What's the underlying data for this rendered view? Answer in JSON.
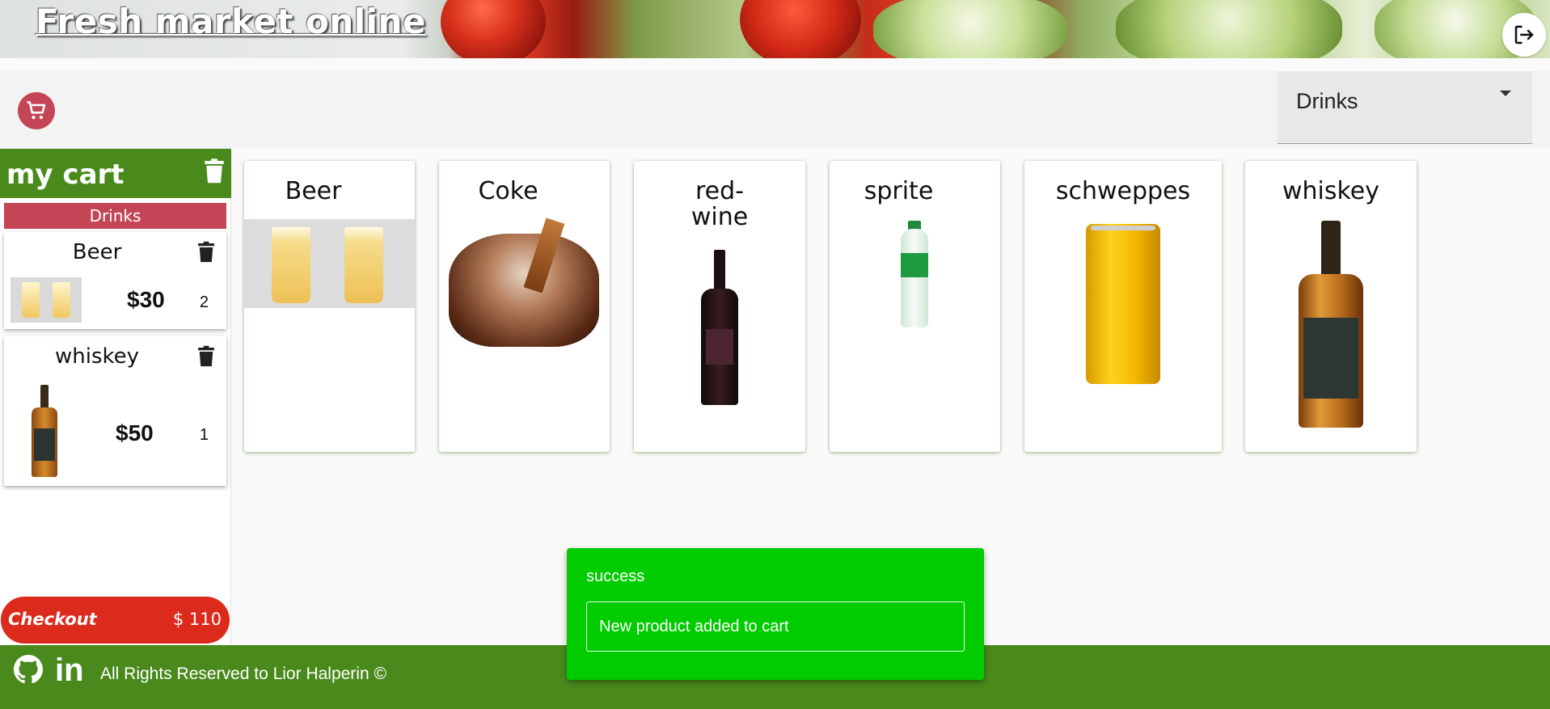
{
  "header": {
    "site_title": "Fresh market online"
  },
  "toolbar": {
    "category_selected": "Drinks"
  },
  "cart": {
    "title": "my cart",
    "group_label": "Drinks",
    "items": [
      {
        "name": "Beer",
        "price": "$30",
        "qty": "2"
      },
      {
        "name": "whiskey",
        "price": "$50",
        "qty": "1"
      }
    ],
    "checkout_label": "Checkout",
    "total": "$ 110"
  },
  "products": [
    {
      "name": "Beer"
    },
    {
      "name": "Coke"
    },
    {
      "name": "red-\nwine"
    },
    {
      "name": "sprite"
    },
    {
      "name": "schweppes"
    },
    {
      "name": "whiskey"
    }
  ],
  "toast": {
    "title": "success",
    "message": "New product added to cart"
  },
  "footer": {
    "linkedin_label": "in",
    "copyright": "All Rights Reserved to Lior Halperin ©"
  },
  "colors": {
    "green": "#4a8a1c",
    "pink": "#c44555",
    "red": "#dc2a1c",
    "toast": "#00cc00"
  },
  "icons": [
    "logout-icon",
    "cart-icon",
    "trash-icon",
    "github-icon",
    "linkedin-icon"
  ]
}
